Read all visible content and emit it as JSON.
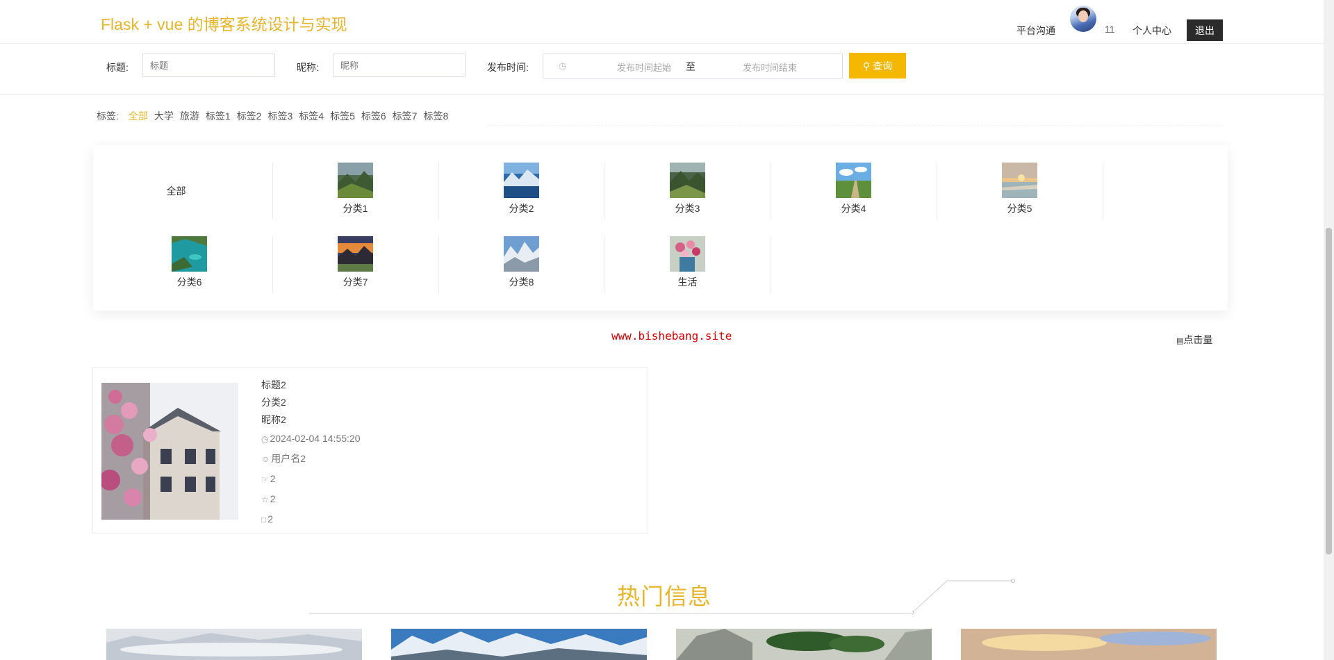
{
  "header": {
    "site_title": "Flask + vue 的博客系统设计与实现",
    "nav_chat": "平台沟通",
    "message_count": "11",
    "nav_profile": "个人中心",
    "logout": "退出"
  },
  "search": {
    "title_label": "标题:",
    "title_placeholder": "标题",
    "nickname_label": "昵称:",
    "nickname_placeholder": "昵称",
    "time_label": "发布时间:",
    "time_start_placeholder": "发布时间起始",
    "time_sep": "至",
    "time_end_placeholder": "发布时间结束",
    "button": "查询"
  },
  "tags": {
    "label": "标签:",
    "items": [
      "全部",
      "大学",
      "旅游",
      "标签1",
      "标签2",
      "标签3",
      "标签4",
      "标签5",
      "标签6",
      "标签7",
      "标签8"
    ],
    "active": "全部"
  },
  "categories": [
    {
      "name": "全部"
    },
    {
      "name": "分类1"
    },
    {
      "name": "分类2"
    },
    {
      "name": "分类3"
    },
    {
      "name": "分类4"
    },
    {
      "name": "分类5"
    },
    {
      "name": "分类6"
    },
    {
      "name": "分类7"
    },
    {
      "name": "分类8"
    },
    {
      "name": "生活"
    }
  ],
  "watermark": "www.bishebang.site",
  "sort_label": "点击量",
  "posts": [
    {
      "title": "标题2",
      "category": "分类2",
      "nickname": "昵称2",
      "published": "2024-02-04 14:55:20",
      "username": "用户名2",
      "likes": "2",
      "favorites": "2",
      "comments": "2"
    }
  ],
  "hot": {
    "title": "热门信息"
  },
  "colors": {
    "accent": "#e7b52c",
    "button": "#f5b800",
    "logout_bg": "#2b2b2b",
    "watermark": "#d40000"
  }
}
